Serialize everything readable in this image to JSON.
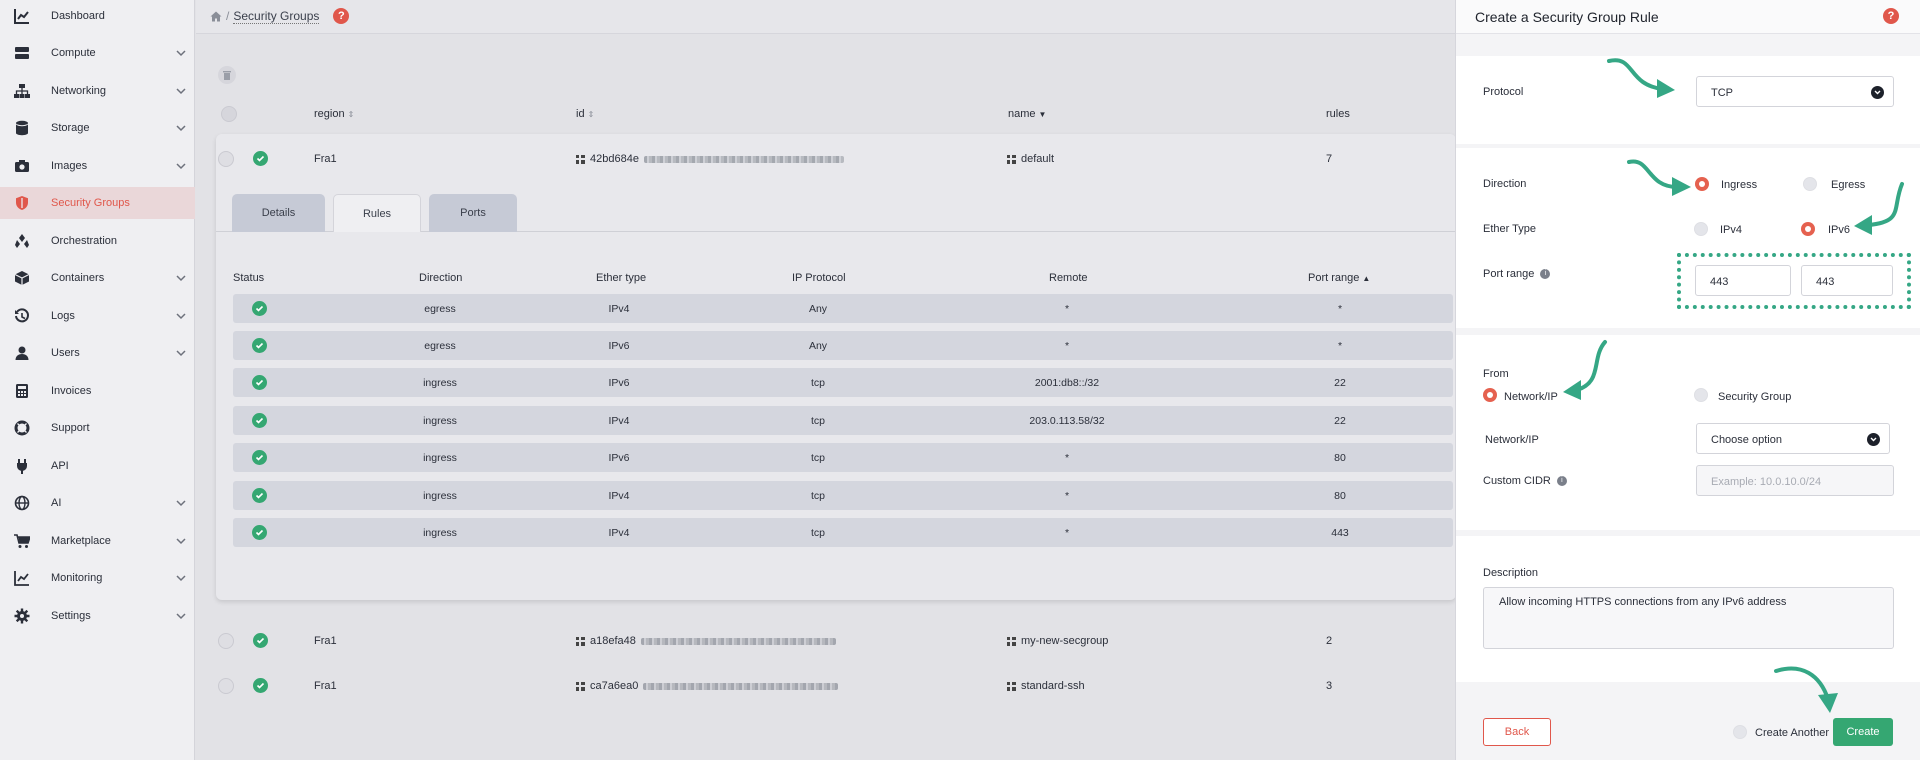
{
  "sidebar": {
    "items": [
      {
        "label": "Dashboard",
        "icon": "chart-icon",
        "chevron": false
      },
      {
        "label": "Compute",
        "icon": "server-icon",
        "chevron": true
      },
      {
        "label": "Networking",
        "icon": "network-icon",
        "chevron": true
      },
      {
        "label": "Storage",
        "icon": "database-icon",
        "chevron": true
      },
      {
        "label": "Images",
        "icon": "camera-icon",
        "chevron": true
      },
      {
        "label": "Security Groups",
        "icon": "shield-icon",
        "chevron": false,
        "active": true
      },
      {
        "label": "Orchestration",
        "icon": "orchestration-icon",
        "chevron": false
      },
      {
        "label": "Containers",
        "icon": "cube-icon",
        "chevron": true
      },
      {
        "label": "Logs",
        "icon": "history-icon",
        "chevron": true
      },
      {
        "label": "Users",
        "icon": "user-icon",
        "chevron": true
      },
      {
        "label": "Invoices",
        "icon": "calculator-icon",
        "chevron": false
      },
      {
        "label": "Support",
        "icon": "lifebuoy-icon",
        "chevron": false
      },
      {
        "label": "API",
        "icon": "plug-icon",
        "chevron": false
      },
      {
        "label": "AI",
        "icon": "ai-icon",
        "chevron": true
      },
      {
        "label": "Marketplace",
        "icon": "cart-icon",
        "chevron": true
      },
      {
        "label": "Monitoring",
        "icon": "monitoring-icon",
        "chevron": true
      },
      {
        "label": "Settings",
        "icon": "gear-icon",
        "chevron": true
      }
    ]
  },
  "breadcrumb": {
    "separator": "/",
    "current": "Security Groups"
  },
  "help_glyph": "?",
  "groups_table": {
    "columns": {
      "region": "region",
      "id": "id",
      "name": "name",
      "rules": "rules"
    },
    "rows": [
      {
        "region": "Fra1",
        "id_prefix": "42bd684e",
        "name": "default",
        "rules": "7"
      },
      {
        "region": "Fra1",
        "id_prefix": "a18efa48",
        "name": "my-new-secgroup",
        "rules": "2"
      },
      {
        "region": "Fra1",
        "id_prefix": "ca7a6ea0",
        "name": "standard-ssh",
        "rules": "3"
      }
    ]
  },
  "tabs": [
    {
      "label": "Details",
      "active": false
    },
    {
      "label": "Rules",
      "active": true
    },
    {
      "label": "Ports",
      "active": false
    }
  ],
  "rules_table": {
    "columns": [
      "Status",
      "Direction",
      "Ether type",
      "IP Protocol",
      "Remote",
      "Port range"
    ],
    "rows": [
      {
        "direction": "egress",
        "ether": "IPv4",
        "protocol": "Any",
        "remote": "*",
        "port": "*"
      },
      {
        "direction": "egress",
        "ether": "IPv6",
        "protocol": "Any",
        "remote": "*",
        "port": "*"
      },
      {
        "direction": "ingress",
        "ether": "IPv6",
        "protocol": "tcp",
        "remote": "2001:db8::/32",
        "port": "22"
      },
      {
        "direction": "ingress",
        "ether": "IPv4",
        "protocol": "tcp",
        "remote": "203.0.113.58/32",
        "port": "22"
      },
      {
        "direction": "ingress",
        "ether": "IPv6",
        "protocol": "tcp",
        "remote": "*",
        "port": "80"
      },
      {
        "direction": "ingress",
        "ether": "IPv4",
        "protocol": "tcp",
        "remote": "*",
        "port": "80"
      },
      {
        "direction": "ingress",
        "ether": "IPv4",
        "protocol": "tcp",
        "remote": "*",
        "port": "443"
      }
    ]
  },
  "panel": {
    "title": "Create a Security Group Rule",
    "protocol_label": "Protocol",
    "protocol_value": "TCP",
    "direction_label": "Direction",
    "direction_ingress": "Ingress",
    "direction_egress": "Egress",
    "ether_label": "Ether Type",
    "ether_ipv4": "IPv4",
    "ether_ipv6": "IPv6",
    "port_range_label": "Port range",
    "port_min": "443",
    "port_max": "443",
    "from_label": "From",
    "from_network": "Network/IP",
    "from_secgroup": "Security Group",
    "network_ip_label": "Network/IP",
    "network_ip_value": "Choose option",
    "custom_cidr_label": "Custom CIDR",
    "custom_cidr_placeholder": "Example: 10.0.10.0/24",
    "description_label": "Description",
    "description_value": "Allow incoming HTTPS connections from any IPv6 address",
    "back_label": "Back",
    "create_another_label": "Create Another",
    "create_label": "Create"
  },
  "colors": {
    "accent": "#e0574b",
    "success": "#35a772",
    "annotation": "#35a785"
  }
}
